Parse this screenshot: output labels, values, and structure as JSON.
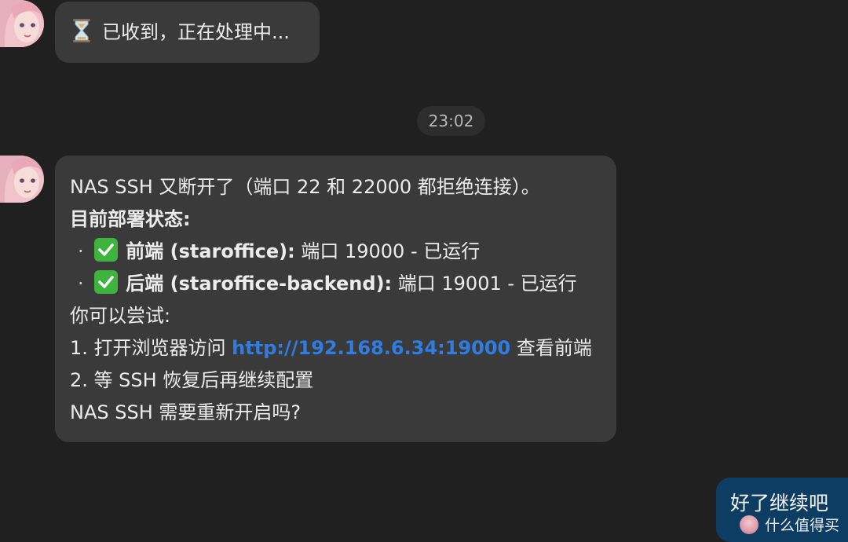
{
  "messages": {
    "first": {
      "icon": "hourglass-icon",
      "text": "已收到，正在处理中..."
    },
    "timestamp": "23:02",
    "second": {
      "line1": "NAS SSH 又断开了（端口 22 和 22000 都拒绝连接）。",
      "status_heading": "目前部署状态:",
      "items": [
        {
          "bullet": "·",
          "icon": "check-mark-icon",
          "label": "前端 (staroffice):",
          "detail": " 端口 19000 - 已运行"
        },
        {
          "bullet": "·",
          "icon": "check-mark-icon",
          "label": "后端 (staroffice-backend):",
          "detail": " 端口 19001 - 已运行"
        }
      ],
      "try_heading": "你可以尝试:",
      "step1_prefix": "1. 打开浏览器访问 ",
      "step1_link": "http://192.168.6.34:19000",
      "step1_suffix": " 查看前端",
      "step2": "2. 等 SSH 恢复后再继续配置",
      "question": "NAS SSH 需要重新开启吗?"
    },
    "reply": {
      "text": "好了继续吧",
      "badge": "什么值得买"
    }
  },
  "colors": {
    "background": "#202020",
    "bubble": "#3a3a3a",
    "user_bubble": "#0e3d63",
    "link": "#2f7de1",
    "check": "#3eb33e"
  }
}
